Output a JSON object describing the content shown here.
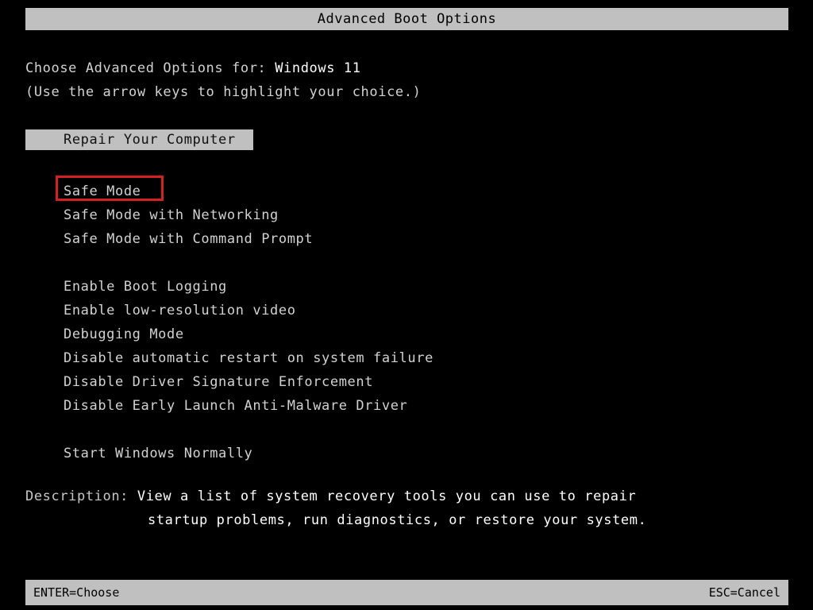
{
  "screen": {
    "title": "Advanced Boot Options",
    "background_color": "#000000",
    "bar_color": "#c0c0c0",
    "text_color": "#d2d2d2",
    "focus_color": "#d42020"
  },
  "intro": {
    "line1_prefix": "Choose Advanced Options for: ",
    "os_name": "Windows 11",
    "line2": "(Use the arrow keys to highlight your choice.)"
  },
  "highlighted_option": {
    "label": "Repair Your Computer"
  },
  "menu": {
    "items": [
      {
        "label": "Safe Mode",
        "focused": true
      },
      {
        "label": "Safe Mode with Networking",
        "focused": false
      },
      {
        "label": "Safe Mode with Command Prompt",
        "focused": false
      },
      {
        "label": "",
        "focused": false
      },
      {
        "label": "Enable Boot Logging",
        "focused": false
      },
      {
        "label": "Enable low-resolution video",
        "focused": false
      },
      {
        "label": "Debugging Mode",
        "focused": false
      },
      {
        "label": "Disable automatic restart on system failure",
        "focused": false
      },
      {
        "label": "Disable Driver Signature Enforcement",
        "focused": false
      },
      {
        "label": "Disable Early Launch Anti-Malware Driver",
        "focused": false
      },
      {
        "label": "",
        "focused": false
      },
      {
        "label": "Start Windows Normally",
        "focused": false
      }
    ]
  },
  "description": {
    "label": "Description: ",
    "line1": "View a list of system recovery tools you can use to repair",
    "line2": "startup problems, run diagnostics, or restore your system."
  },
  "statusbar": {
    "left": "ENTER=Choose",
    "right": "ESC=Cancel"
  }
}
